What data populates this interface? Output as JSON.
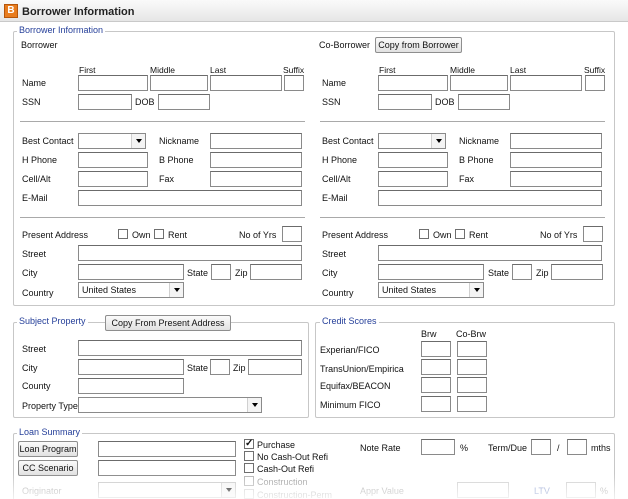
{
  "window": {
    "icon_letter": "B",
    "title": "Borrower Information"
  },
  "borrower_info": {
    "section_title": "Borrower Information",
    "borrower": {
      "heading": "Borrower",
      "name_label": "Name",
      "first": "First",
      "middle": "Middle",
      "last": "Last",
      "suffix": "Suffix",
      "ssn": "SSN",
      "dob": "DOB",
      "best_contact": "Best Contact",
      "nickname": "Nickname",
      "h_phone": "H Phone",
      "b_phone": "B Phone",
      "cell": "Cell/Alt",
      "fax": "Fax",
      "email": "E-Mail",
      "present_address": "Present Address",
      "own": "Own",
      "rent": "Rent",
      "no_of_yrs": "No of Yrs",
      "street": "Street",
      "city": "City",
      "state": "State",
      "zip": "Zip",
      "country": "Country",
      "country_value": "United States"
    },
    "coborrower": {
      "heading": "Co-Borrower",
      "copy_button": "Copy from Borrower",
      "name_label": "Name",
      "first": "First",
      "middle": "Middle",
      "last": "Last",
      "suffix": "Suffix",
      "ssn": "SSN",
      "dob": "DOB",
      "best_contact": "Best Contact",
      "nickname": "Nickname",
      "h_phone": "H Phone",
      "b_phone": "B Phone",
      "cell": "Cell/Alt",
      "fax": "Fax",
      "email": "E-Mail",
      "present_address": "Present Address",
      "own": "Own",
      "rent": "Rent",
      "no_of_yrs": "No of Yrs",
      "street": "Street",
      "city": "City",
      "state": "State",
      "zip": "Zip",
      "country": "Country",
      "country_value": "United States"
    }
  },
  "subject_property": {
    "title": "Subject Property",
    "copy_button": "Copy From Present Address",
    "street": "Street",
    "city": "City",
    "state": "State",
    "zip": "Zip",
    "county": "County",
    "property_type": "Property Type"
  },
  "credit_scores": {
    "title": "Credit Scores",
    "col_brw": "Brw",
    "col_cobrw": "Co-Brw",
    "rows": [
      "Experian/FICO",
      "TransUnion/Empirica",
      "Equifax/BEACON",
      "Minimum FICO"
    ]
  },
  "loan_summary": {
    "title": "Loan Summary",
    "loan_program_button": "Loan Program",
    "cc_scenario_button": "CC Scenario",
    "originator": "Originator",
    "purpose": [
      {
        "label": "Purchase",
        "checked": true
      },
      {
        "label": "No Cash-Out Refi",
        "checked": false
      },
      {
        "label": "Cash-Out Refi",
        "checked": false
      },
      {
        "label": "Construction",
        "checked": false
      },
      {
        "label": "Construction-Perm",
        "checked": false
      }
    ],
    "note_rate": "Note Rate",
    "percent": "%",
    "term_due": "Term/Due",
    "slash": "/",
    "mths": "mths",
    "appr_value": "Appr Value",
    "ltv": "LTV",
    "ltv_percent": "%"
  }
}
